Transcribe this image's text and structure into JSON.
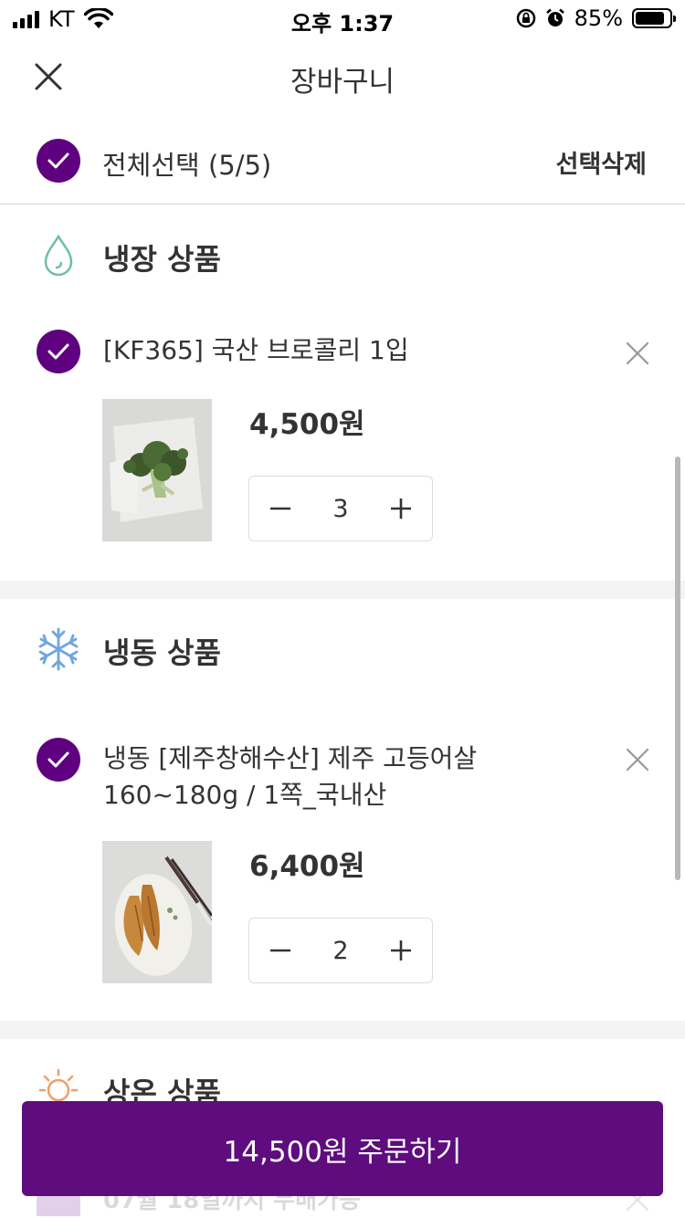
{
  "status_bar": {
    "carrier": "KT",
    "time": "오후 1:37",
    "battery_percent": "85%",
    "battery_level": 0.85
  },
  "header": {
    "title": "장바구니",
    "close_icon": "close-icon"
  },
  "select_all": {
    "label": "전체선택 (5/5)",
    "delete_label": "선택삭제",
    "checked": true
  },
  "sections": {
    "chilled": {
      "title": "냉장 상품",
      "icon": "water-drop-icon",
      "items": [
        {
          "name": "[KF365] 국산 브로콜리 1입",
          "price": "4,500원",
          "quantity": "3",
          "checked": true
        }
      ]
    },
    "frozen": {
      "title": "냉동 상품",
      "icon": "snowflake-icon",
      "items": [
        {
          "name": "냉동 [제주창해수산] 제주 고등어살 160~180g / 1쪽_국내산",
          "price": "6,400원",
          "quantity": "2",
          "checked": true
        }
      ]
    },
    "room_temp": {
      "title": "상온 상품",
      "icon": "sun-icon",
      "partial_item_text": "07월 18일까지 무배가능"
    }
  },
  "order_button": {
    "label": "14,500원 주문하기"
  },
  "colors": {
    "brand_purple": "#5f0080",
    "order_button": "#5f0c7e",
    "text": "#333333",
    "divider": "#f4f4f4"
  }
}
